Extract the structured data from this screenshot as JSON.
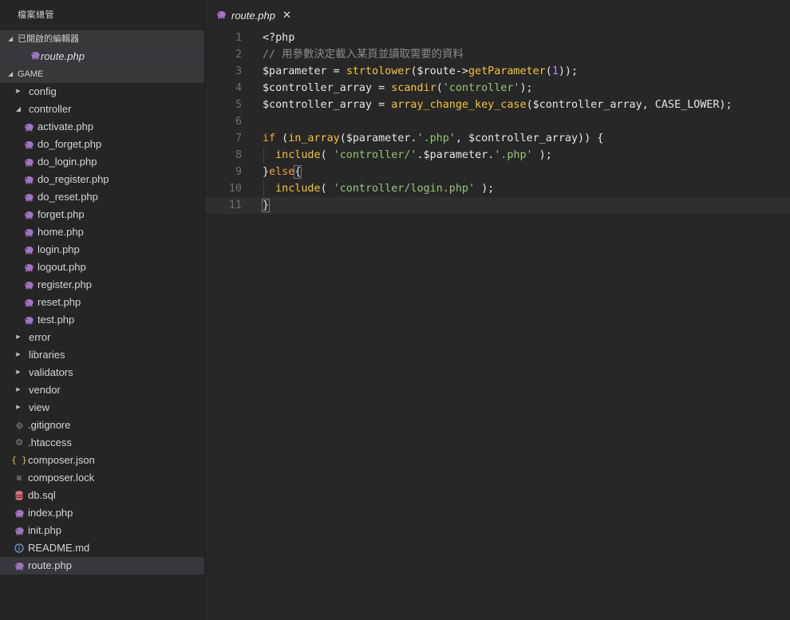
{
  "sidebar": {
    "title": "檔案總管",
    "open_editors": {
      "label": "已開啟的編輯器",
      "items": [
        {
          "name": "route.php",
          "icon": "php-icon"
        }
      ]
    },
    "project": {
      "label": "GAME",
      "items": [
        {
          "name": "config",
          "type": "folder",
          "expanded": false,
          "level": 0
        },
        {
          "name": "controller",
          "type": "folder",
          "expanded": true,
          "level": 0
        },
        {
          "name": "activate.php",
          "type": "file",
          "icon": "php-icon",
          "level": 1
        },
        {
          "name": "do_forget.php",
          "type": "file",
          "icon": "php-icon",
          "level": 1
        },
        {
          "name": "do_login.php",
          "type": "file",
          "icon": "php-icon",
          "level": 1
        },
        {
          "name": "do_register.php",
          "type": "file",
          "icon": "php-icon",
          "level": 1
        },
        {
          "name": "do_reset.php",
          "type": "file",
          "icon": "php-icon",
          "level": 1
        },
        {
          "name": "forget.php",
          "type": "file",
          "icon": "php-icon",
          "level": 1
        },
        {
          "name": "home.php",
          "type": "file",
          "icon": "php-icon",
          "level": 1
        },
        {
          "name": "login.php",
          "type": "file",
          "icon": "php-icon",
          "level": 1
        },
        {
          "name": "logout.php",
          "type": "file",
          "icon": "php-icon",
          "level": 1
        },
        {
          "name": "register.php",
          "type": "file",
          "icon": "php-icon",
          "level": 1
        },
        {
          "name": "reset.php",
          "type": "file",
          "icon": "php-icon",
          "level": 1
        },
        {
          "name": "test.php",
          "type": "file",
          "icon": "php-icon",
          "level": 1
        },
        {
          "name": "error",
          "type": "folder",
          "expanded": false,
          "level": 0
        },
        {
          "name": "libraries",
          "type": "folder",
          "expanded": false,
          "level": 0
        },
        {
          "name": "validators",
          "type": "folder",
          "expanded": false,
          "level": 0
        },
        {
          "name": "vendor",
          "type": "folder",
          "expanded": false,
          "level": 0
        },
        {
          "name": "view",
          "type": "folder",
          "expanded": false,
          "level": 0
        },
        {
          "name": ".gitignore",
          "type": "file",
          "icon": "git-icon",
          "level": 0
        },
        {
          "name": ".htaccess",
          "type": "file",
          "icon": "gear-icon",
          "level": 0
        },
        {
          "name": "composer.json",
          "type": "file",
          "icon": "braces-icon",
          "level": 0
        },
        {
          "name": "composer.lock",
          "type": "file",
          "icon": "lines-icon",
          "level": 0
        },
        {
          "name": "db.sql",
          "type": "file",
          "icon": "database-icon",
          "level": 0
        },
        {
          "name": "index.php",
          "type": "file",
          "icon": "php-icon",
          "level": 0
        },
        {
          "name": "init.php",
          "type": "file",
          "icon": "php-icon",
          "level": 0
        },
        {
          "name": "README.md",
          "type": "file",
          "icon": "info-icon",
          "level": 0
        },
        {
          "name": "route.php",
          "type": "file",
          "icon": "php-icon",
          "level": 0,
          "selected": true
        }
      ]
    }
  },
  "editor": {
    "tab": {
      "label": "route.php",
      "close": "✕"
    },
    "current_line": 11,
    "lines": [
      [
        [
          "t-var",
          "<?php"
        ]
      ],
      [
        [
          "t-cmt",
          "// 用參數決定載入某頁並讀取需要的資料"
        ]
      ],
      [
        [
          "t-var",
          "$parameter = "
        ],
        [
          "t-fn",
          "strtolower"
        ],
        [
          "t-var",
          "($route->"
        ],
        [
          "t-fn",
          "getParameter"
        ],
        [
          "t-var",
          "("
        ],
        [
          "t-num",
          "1"
        ],
        [
          "t-var",
          "));"
        ]
      ],
      [
        [
          "t-var",
          "$controller_array = "
        ],
        [
          "t-fn",
          "scandir"
        ],
        [
          "t-var",
          "("
        ],
        [
          "t-str",
          "'controller'"
        ],
        [
          "t-var",
          ");"
        ]
      ],
      [
        [
          "t-var",
          "$controller_array = "
        ],
        [
          "t-fn",
          "array_change_key_case"
        ],
        [
          "t-var",
          "($controller_array, CASE_LOWER);"
        ]
      ],
      [
        [
          "t-var",
          ""
        ]
      ],
      [
        [
          "t-kw",
          "if"
        ],
        [
          "t-var",
          " ("
        ],
        [
          "t-fn",
          "in_array"
        ],
        [
          "t-var",
          "($parameter."
        ],
        [
          "t-str",
          "'.php'"
        ],
        [
          "t-var",
          ", $controller_array)) {"
        ]
      ],
      [
        [
          "t-var",
          "  "
        ],
        [
          "t-inc",
          "include"
        ],
        [
          "t-var",
          "( "
        ],
        [
          "t-str",
          "'controller/'"
        ],
        [
          "t-var",
          ".$parameter."
        ],
        [
          "t-str",
          "'.php'"
        ],
        [
          "t-var",
          " );"
        ]
      ],
      [
        [
          "t-var",
          "}"
        ],
        [
          "t-kw",
          "else"
        ],
        [
          "t-var",
          "{"
        ]
      ],
      [
        [
          "t-var",
          "  "
        ],
        [
          "t-inc",
          "include"
        ],
        [
          "t-var",
          "( "
        ],
        [
          "t-str",
          "'controller/login.php'"
        ],
        [
          "t-var",
          " );"
        ]
      ],
      [
        [
          "t-var",
          "}"
        ]
      ]
    ]
  }
}
